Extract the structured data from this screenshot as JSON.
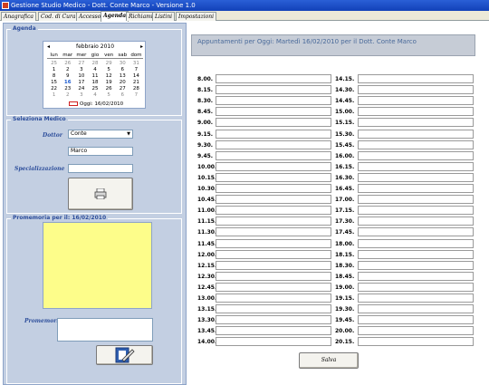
{
  "window": {
    "title": "Gestione Studio Medico  -  Dott. Conte Marco  -  Versione 1.0"
  },
  "tabs": [
    {
      "label": "Anagrafica"
    },
    {
      "label": "Cod. di Cura"
    },
    {
      "label": "Accesso"
    },
    {
      "label": "Agenda"
    },
    {
      "label": "Richiami"
    },
    {
      "label": "Listini"
    },
    {
      "label": "Impostazioni"
    }
  ],
  "left": {
    "agenda_title": "Agenda",
    "calendar": {
      "month_label": "febbraio 2010",
      "prev": "◂",
      "next": "▸",
      "weekdays": [
        "lun",
        "mar",
        "mer",
        "gio",
        "ven",
        "sab",
        "dom"
      ],
      "days": [
        {
          "d": "25",
          "dim": true
        },
        {
          "d": "26",
          "dim": true
        },
        {
          "d": "27",
          "dim": true
        },
        {
          "d": "28",
          "dim": true
        },
        {
          "d": "29",
          "dim": true
        },
        {
          "d": "30",
          "dim": true
        },
        {
          "d": "31",
          "dim": true
        },
        {
          "d": "1"
        },
        {
          "d": "2"
        },
        {
          "d": "3"
        },
        {
          "d": "4"
        },
        {
          "d": "5"
        },
        {
          "d": "6"
        },
        {
          "d": "7"
        },
        {
          "d": "8"
        },
        {
          "d": "9"
        },
        {
          "d": "10"
        },
        {
          "d": "11"
        },
        {
          "d": "12"
        },
        {
          "d": "13"
        },
        {
          "d": "14"
        },
        {
          "d": "15"
        },
        {
          "d": "16",
          "today": true
        },
        {
          "d": "17"
        },
        {
          "d": "18"
        },
        {
          "d": "19"
        },
        {
          "d": "20"
        },
        {
          "d": "21"
        },
        {
          "d": "22"
        },
        {
          "d": "23"
        },
        {
          "d": "24"
        },
        {
          "d": "25"
        },
        {
          "d": "26"
        },
        {
          "d": "27"
        },
        {
          "d": "28"
        },
        {
          "d": "1",
          "dim": true
        },
        {
          "d": "2",
          "dim": true
        },
        {
          "d": "3",
          "dim": true
        },
        {
          "d": "4",
          "dim": true
        },
        {
          "d": "5",
          "dim": true
        },
        {
          "d": "6",
          "dim": true
        },
        {
          "d": "7",
          "dim": true
        }
      ],
      "today_label": "Oggi: 16/02/2010"
    },
    "doctor_group_title": "Seleziona Medico",
    "doctor_label": "Dottor",
    "doctor_value": "Conte",
    "doctor_name": "Marco",
    "specialization_label": "Specializzazione",
    "specialization_value": "",
    "memo_title": "Promemoria per il: 16/02/2010",
    "memo_label": "Promemoria",
    "memo_value": ""
  },
  "right": {
    "header": "Appuntamenti per Oggi:  Martedì 16/02/2010 per il Dott. Conte Marco",
    "col1": [
      "8.00.",
      "8.15.",
      "8.30.",
      "8.45.",
      "9.00.",
      "9.15.",
      "9.30.",
      "9.45.",
      "10.00.",
      "10.15.",
      "10.30.",
      "10.45.",
      "11.00.",
      "11.15.",
      "11.30.",
      "11.45.",
      "12.00.",
      "12.15.",
      "12.30.",
      "12.45.",
      "13.00.",
      "13.15.",
      "13.30.",
      "13.45.",
      "14.00."
    ],
    "col2": [
      "14.15.",
      "14.30.",
      "14.45.",
      "15.00.",
      "15.15.",
      "15.30.",
      "15.45.",
      "16.00.",
      "16.15.",
      "16.30.",
      "16.45.",
      "17.00.",
      "17.15.",
      "17.30.",
      "17.45.",
      "18.00.",
      "18.15.",
      "18.30.",
      "18.45.",
      "19.00.",
      "19.15.",
      "19.30.",
      "19.45.",
      "20.00.",
      "20.15."
    ],
    "save_label": "Salva"
  }
}
